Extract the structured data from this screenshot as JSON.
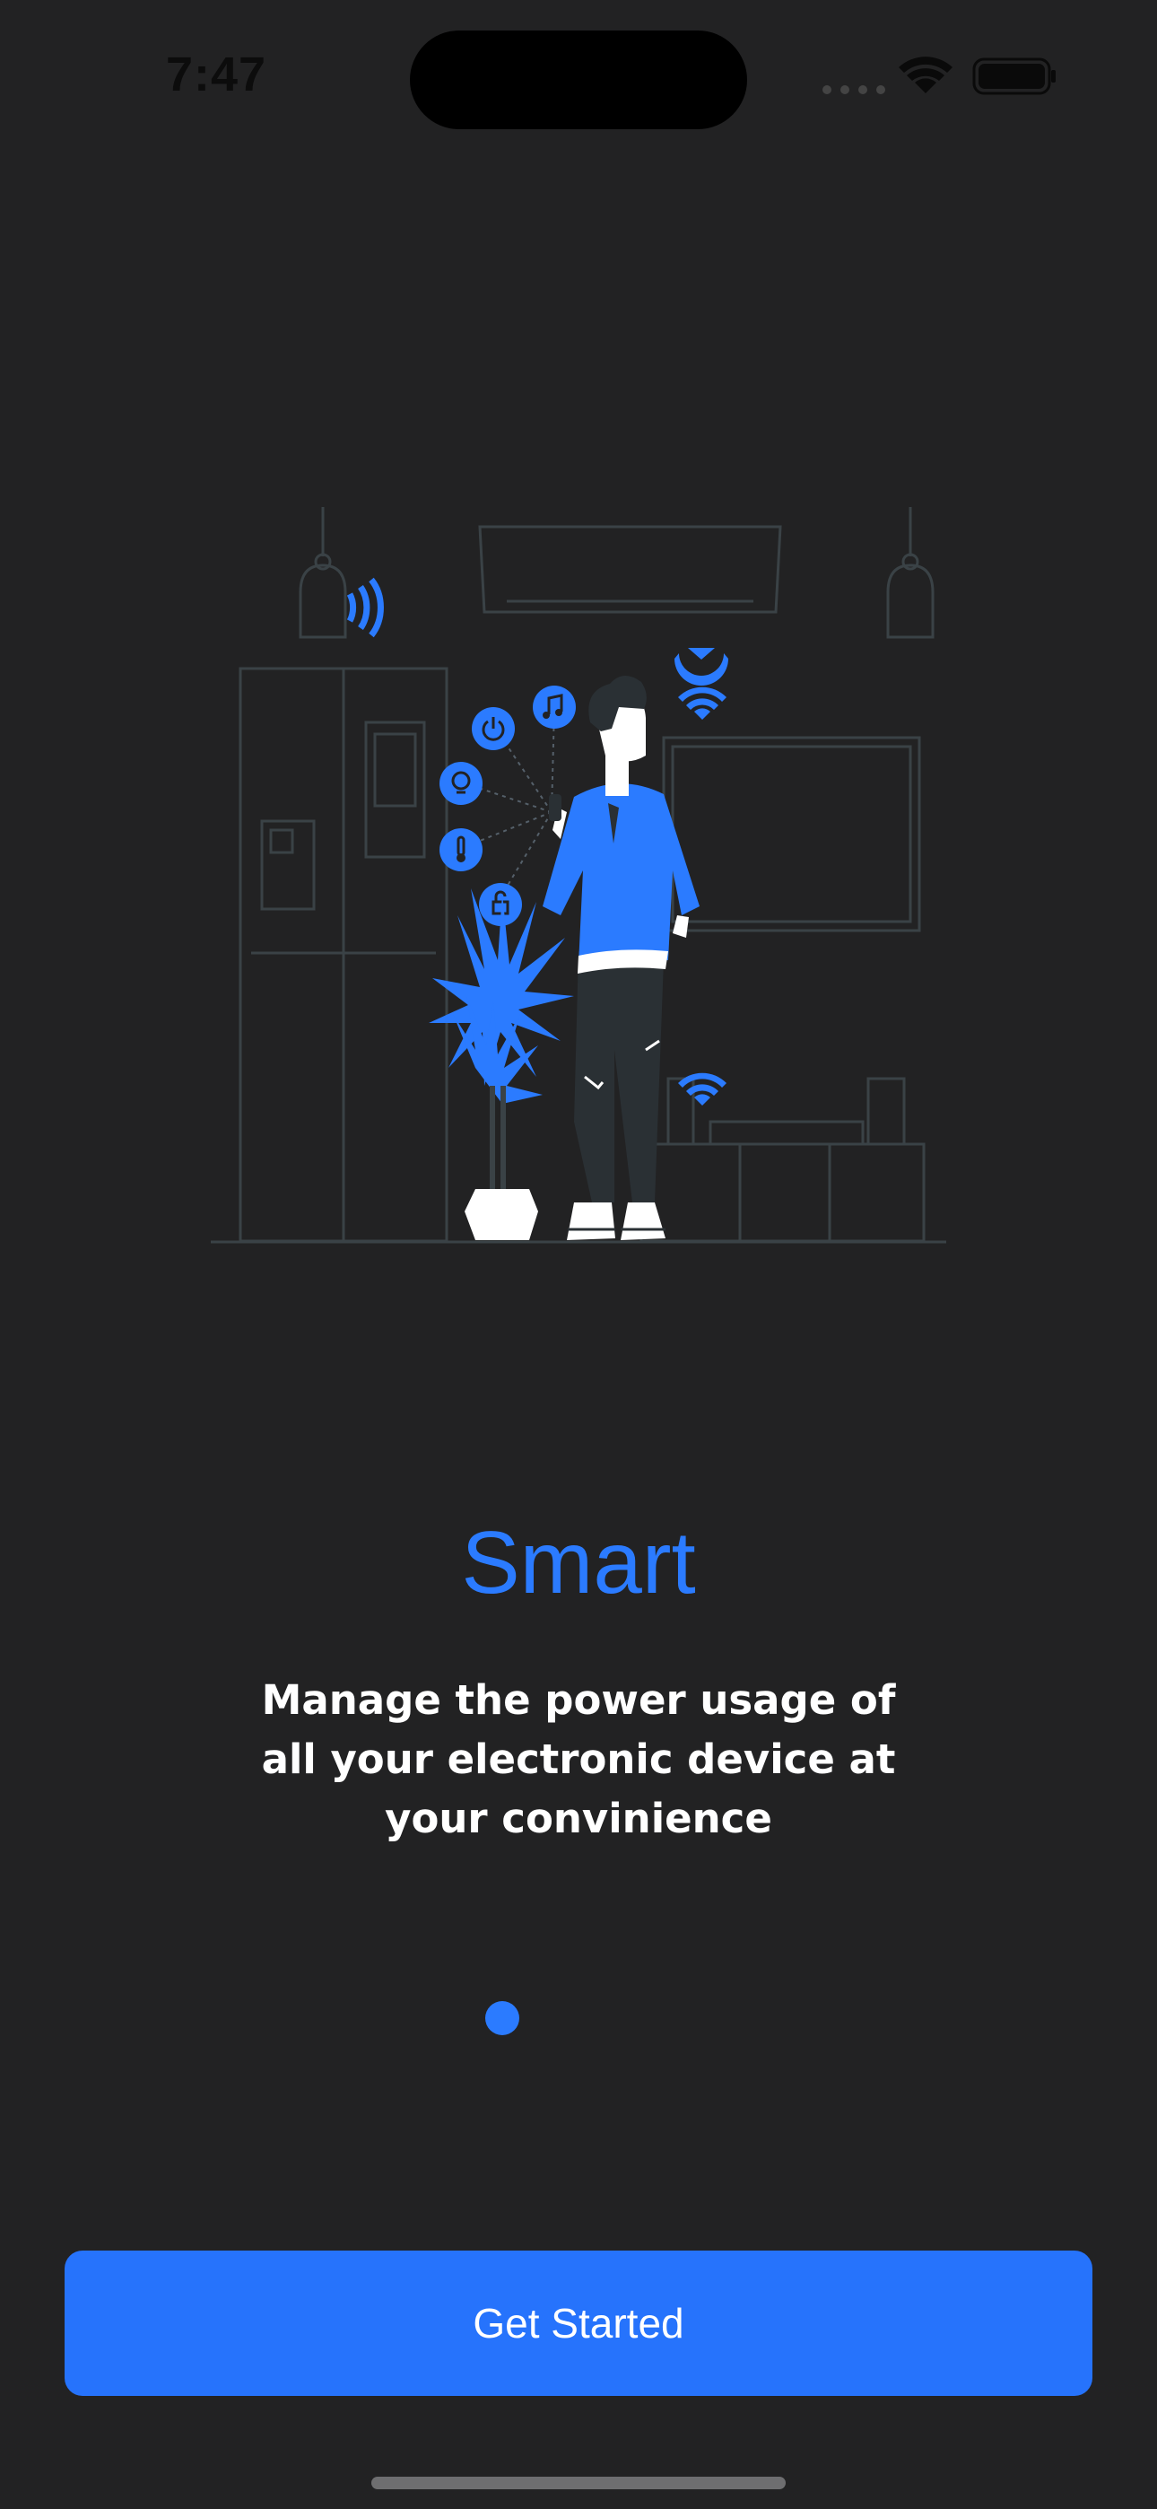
{
  "status_bar": {
    "time": "7:47"
  },
  "onboarding": {
    "title": "Smart",
    "description": "Manage the power usage of all your electronic device at your convinience",
    "page_indicator": {
      "pages": 1,
      "active_index": 0
    },
    "illustration_icon": "person-smart-home-illustration"
  },
  "actions": {
    "get_started_label": "Get Started"
  },
  "colors": {
    "background": "#222223",
    "accent": "#2b7bff",
    "button": "#2673fc",
    "text": "#ffffff"
  }
}
